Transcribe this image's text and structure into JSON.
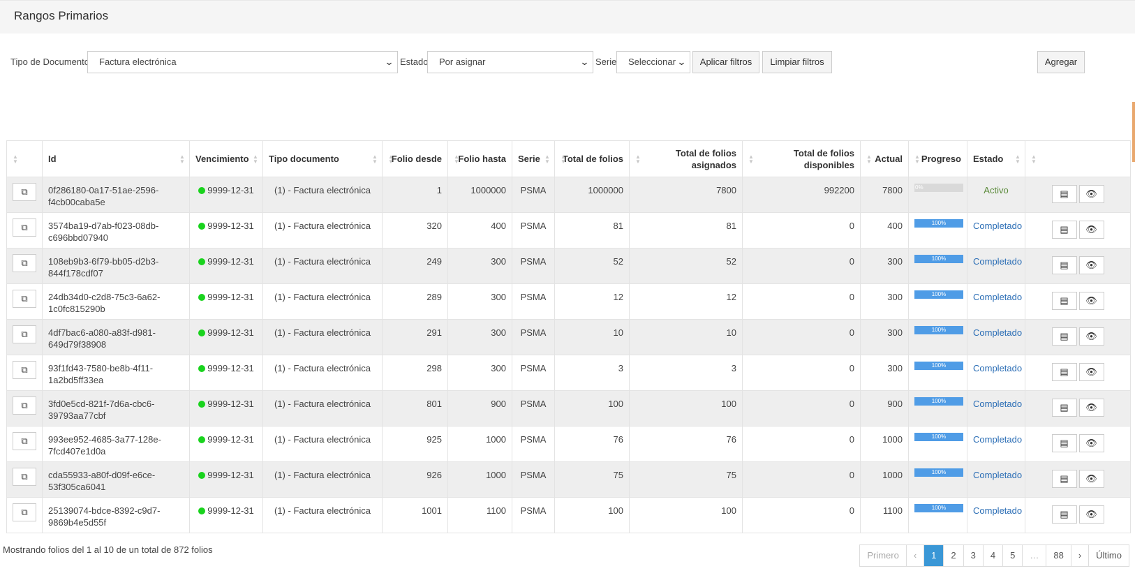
{
  "page": {
    "title": "Rangos Primarios"
  },
  "filters": {
    "tipo_label": "Tipo de Documento",
    "tipo_value": "Factura electrónica",
    "estado_label": "Estado",
    "estado_value": "Por asignar",
    "serie_label": "Serie",
    "serie_value": "Seleccionar",
    "apply_label": "Aplicar filtros",
    "clear_label": "Limpiar filtros",
    "add_label": "Agregar"
  },
  "table": {
    "headers": {
      "id": "Id",
      "vencimiento": "Vencimiento",
      "tipo": "Tipo documento",
      "folio_desde": "Folio desde",
      "folio_hasta": "Folio hasta",
      "serie": "Serie",
      "total_folios": "Total de folios",
      "total_asignados": "Total de folios asignados",
      "total_disponibles": "Total de folios disponibles",
      "actual": "Actual",
      "progreso": "Progreso",
      "estado": "Estado"
    },
    "rows": [
      {
        "id": "0f286180-0a17-51ae-2596-f4cb00caba5e",
        "vencimiento": "9999-12-31",
        "tipo": "(1) - Factura electrónica",
        "desde": "1",
        "hasta": "1000000",
        "serie": "PSMA",
        "total": "1000000",
        "asignados": "7800",
        "disponibles": "992200",
        "actual": "7800",
        "progress": 0,
        "progress_label": "0%",
        "estado": "Activo"
      },
      {
        "id": "3574ba19-d7ab-f023-08db-c696bbd07940",
        "vencimiento": "9999-12-31",
        "tipo": "(1) - Factura electrónica",
        "desde": "320",
        "hasta": "400",
        "serie": "PSMA",
        "total": "81",
        "asignados": "81",
        "disponibles": "0",
        "actual": "400",
        "progress": 100,
        "progress_label": "100%",
        "estado": "Completado"
      },
      {
        "id": "108eb9b3-6f79-bb05-d2b3-844f178cdf07",
        "vencimiento": "9999-12-31",
        "tipo": "(1) - Factura electrónica",
        "desde": "249",
        "hasta": "300",
        "serie": "PSMA",
        "total": "52",
        "asignados": "52",
        "disponibles": "0",
        "actual": "300",
        "progress": 100,
        "progress_label": "100%",
        "estado": "Completado"
      },
      {
        "id": "24db34d0-c2d8-75c3-6a62-1c0fc815290b",
        "vencimiento": "9999-12-31",
        "tipo": "(1) - Factura electrónica",
        "desde": "289",
        "hasta": "300",
        "serie": "PSMA",
        "total": "12",
        "asignados": "12",
        "disponibles": "0",
        "actual": "300",
        "progress": 100,
        "progress_label": "100%",
        "estado": "Completado"
      },
      {
        "id": "4df7bac6-a080-a83f-d981-649d79f38908",
        "vencimiento": "9999-12-31",
        "tipo": "(1) - Factura electrónica",
        "desde": "291",
        "hasta": "300",
        "serie": "PSMA",
        "total": "10",
        "asignados": "10",
        "disponibles": "0",
        "actual": "300",
        "progress": 100,
        "progress_label": "100%",
        "estado": "Completado"
      },
      {
        "id": "93f1fd43-7580-be8b-4f11-1a2bd5ff33ea",
        "vencimiento": "9999-12-31",
        "tipo": "(1) - Factura electrónica",
        "desde": "298",
        "hasta": "300",
        "serie": "PSMA",
        "total": "3",
        "asignados": "3",
        "disponibles": "0",
        "actual": "300",
        "progress": 100,
        "progress_label": "100%",
        "estado": "Completado"
      },
      {
        "id": "3fd0e5cd-821f-7d6a-cbc6-39793aa77cbf",
        "vencimiento": "9999-12-31",
        "tipo": "(1) - Factura electrónica",
        "desde": "801",
        "hasta": "900",
        "serie": "PSMA",
        "total": "100",
        "asignados": "100",
        "disponibles": "0",
        "actual": "900",
        "progress": 100,
        "progress_label": "100%",
        "estado": "Completado"
      },
      {
        "id": "993ee952-4685-3a77-128e-7fcd407e1d0a",
        "vencimiento": "9999-12-31",
        "tipo": "(1) - Factura electrónica",
        "desde": "925",
        "hasta": "1000",
        "serie": "PSMA",
        "total": "76",
        "asignados": "76",
        "disponibles": "0",
        "actual": "1000",
        "progress": 100,
        "progress_label": "100%",
        "estado": "Completado"
      },
      {
        "id": "cda55933-a80f-d09f-e6ce-53f305ca6041",
        "vencimiento": "9999-12-31",
        "tipo": "(1) - Factura electrónica",
        "desde": "926",
        "hasta": "1000",
        "serie": "PSMA",
        "total": "75",
        "asignados": "75",
        "disponibles": "0",
        "actual": "1000",
        "progress": 100,
        "progress_label": "100%",
        "estado": "Completado"
      },
      {
        "id": "25139074-bdce-8392-c9d7-9869b4e5d55f",
        "vencimiento": "9999-12-31",
        "tipo": "(1) - Factura electrónica",
        "desde": "1001",
        "hasta": "1100",
        "serie": "PSMA",
        "total": "100",
        "asignados": "100",
        "disponibles": "0",
        "actual": "1100",
        "progress": 100,
        "progress_label": "100%",
        "estado": "Completado"
      }
    ]
  },
  "footer": {
    "info": "Mostrando folios del 1 al 10 de un total de 872 folios",
    "pager": [
      "Primero",
      "‹",
      "1",
      "2",
      "3",
      "4",
      "5",
      "…",
      "88",
      "›",
      "Último"
    ],
    "active_page": "1"
  },
  "colors": {
    "status_dot": "#19d31d",
    "progress_fill": "#4f9ce6",
    "active_page": "#3a97d6",
    "estado_activo": "#5a8a3a",
    "estado_completado": "#2a6db5"
  },
  "icons": {
    "copy": "copy-icon",
    "list": "list-icon",
    "view": "eye-icon",
    "sort": "sort-icon",
    "dropdown": "chevron-down-icon"
  }
}
